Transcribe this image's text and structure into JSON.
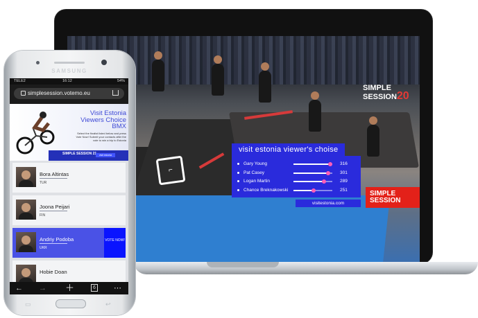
{
  "laptop": {
    "poll_title": "visit estonia viewer's choise",
    "poll_url": "visitestonia.com",
    "brand_text": "SIMPLE SESSION",
    "brand_year": "20",
    "badge_line1": "SIMPLE",
    "badge_line2": "SESSION",
    "poll": [
      {
        "name": "Gary Young",
        "votes": "316",
        "share": 0.95
      },
      {
        "name": "Pat Casey",
        "votes": "301",
        "share": 0.9
      },
      {
        "name": "Logan Martin",
        "votes": "289",
        "share": 0.78
      },
      {
        "name": "Chance Breknakowski",
        "votes": "251",
        "share": 0.52
      }
    ]
  },
  "phone": {
    "brand": "SAMSUNG",
    "status": {
      "carrier": "TELE2",
      "time": "16:12",
      "battery": "54%"
    },
    "url": "simplesession.votemo.eu",
    "banner": {
      "title": "Visit Estonia Viewers Choice BMX",
      "subtitle": "Select the finalist listed below and press Vote Now! Submit your contacts after the vote to win a trip to Estonia",
      "strip_logo": "SIMPLE SESSION 21",
      "strip_button": "visit estonia"
    },
    "riders": [
      {
        "name": "Bora Altintas",
        "country": "TUR",
        "active": false
      },
      {
        "name": "Joona Peijari",
        "country": "FIN",
        "active": false
      },
      {
        "name": "Andriy Podoba",
        "country": "UKR",
        "active": true
      },
      {
        "name": "Hobie Doan",
        "country": "",
        "active": false
      }
    ],
    "vote_label": "VOTE NOW!",
    "tab_count": "6"
  },
  "colors": {
    "accent": "#2a2bdc",
    "vote": "#0a14ff",
    "brand_red": "#e32119"
  }
}
